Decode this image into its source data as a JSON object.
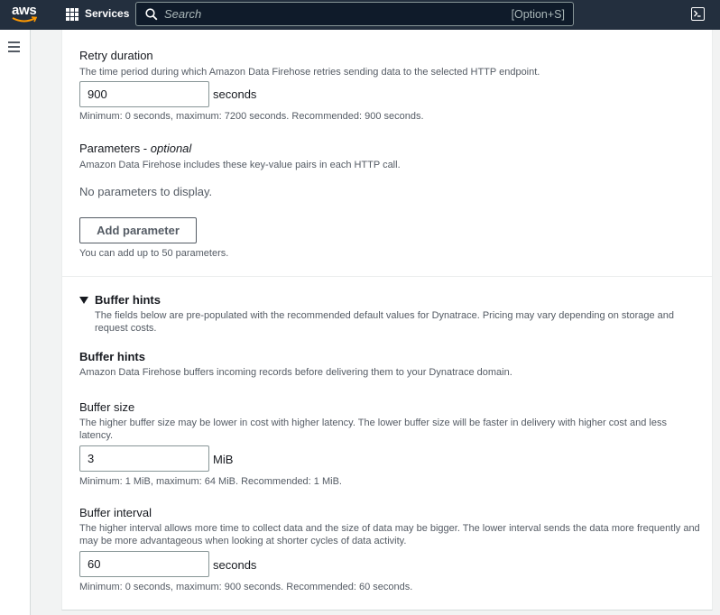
{
  "topnav": {
    "logo": "aws",
    "services_label": "Services",
    "search_placeholder": "Search",
    "search_shortcut": "[Option+S]"
  },
  "retry": {
    "label": "Retry duration",
    "description": "The time period during which Amazon Data Firehose retries sending data to the selected HTTP endpoint.",
    "value": "900",
    "unit": "seconds",
    "constraint": "Minimum: 0 seconds, maximum: 7200 seconds. Recommended: 900 seconds."
  },
  "parameters": {
    "label": "Parameters - ",
    "label_optional": "optional",
    "description": "Amazon Data Firehose includes these key-value pairs in each HTTP call.",
    "empty_text": "No parameters to display.",
    "add_button": "Add parameter",
    "limit_text": "You can add up to 50 parameters."
  },
  "buffer_section": {
    "toggle_label": "Buffer hints",
    "toggle_description": "The fields below are pre-populated with the recommended default values for Dynatrace. Pricing may vary depending on storage and request costs.",
    "heading": "Buffer hints",
    "heading_description": "Amazon Data Firehose buffers incoming records before delivering them to your Dynatrace domain."
  },
  "buffer_size": {
    "label": "Buffer size",
    "description": "The higher buffer size may be lower in cost with higher latency. The lower buffer size will be faster in delivery with higher cost and less latency.",
    "value": "3",
    "unit": "MiB",
    "constraint": "Minimum: 1 MiB, maximum: 64 MiB. Recommended: 1 MiB."
  },
  "buffer_interval": {
    "label": "Buffer interval",
    "description": "The higher interval allows more time to collect data and the size of data may be bigger. The lower interval sends the data more frequently and may be more advantageous when looking at shorter cycles of data activity.",
    "value": "60",
    "unit": "seconds",
    "constraint": "Minimum: 0 seconds, maximum: 900 seconds. Recommended: 60 seconds."
  },
  "icons": [
    "aws-logo-icon",
    "services-grid-icon",
    "search-icon",
    "cloudshell-icon",
    "menu-icon",
    "caret-down-icon"
  ],
  "colors": {
    "nav_bg": "#232f3e",
    "text": "#16191f",
    "muted": "#545b64",
    "border": "#879596",
    "accent": "#ff9900"
  }
}
